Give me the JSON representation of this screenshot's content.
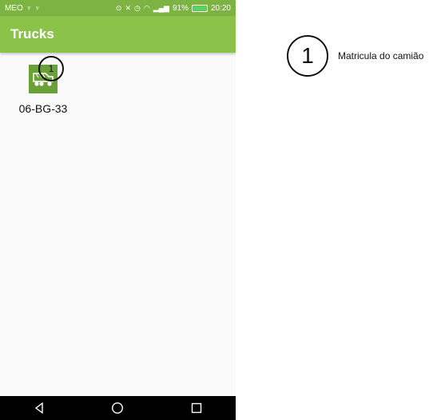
{
  "status_bar": {
    "carrier": "MEO",
    "battery_percent": "91%",
    "time": "20:20",
    "background": "#7cb342"
  },
  "app_bar": {
    "title": "Trucks",
    "color": "#8bc34a"
  },
  "trucks": [
    {
      "plate": "06-BG-33",
      "icon": "truck-icon"
    }
  ],
  "annotation": {
    "marker_number": "1",
    "legend_number": "1",
    "legend_text": "Matricula do camião"
  },
  "nav": {
    "back": "back-icon",
    "home": "home-icon",
    "recents": "recents-icon"
  }
}
